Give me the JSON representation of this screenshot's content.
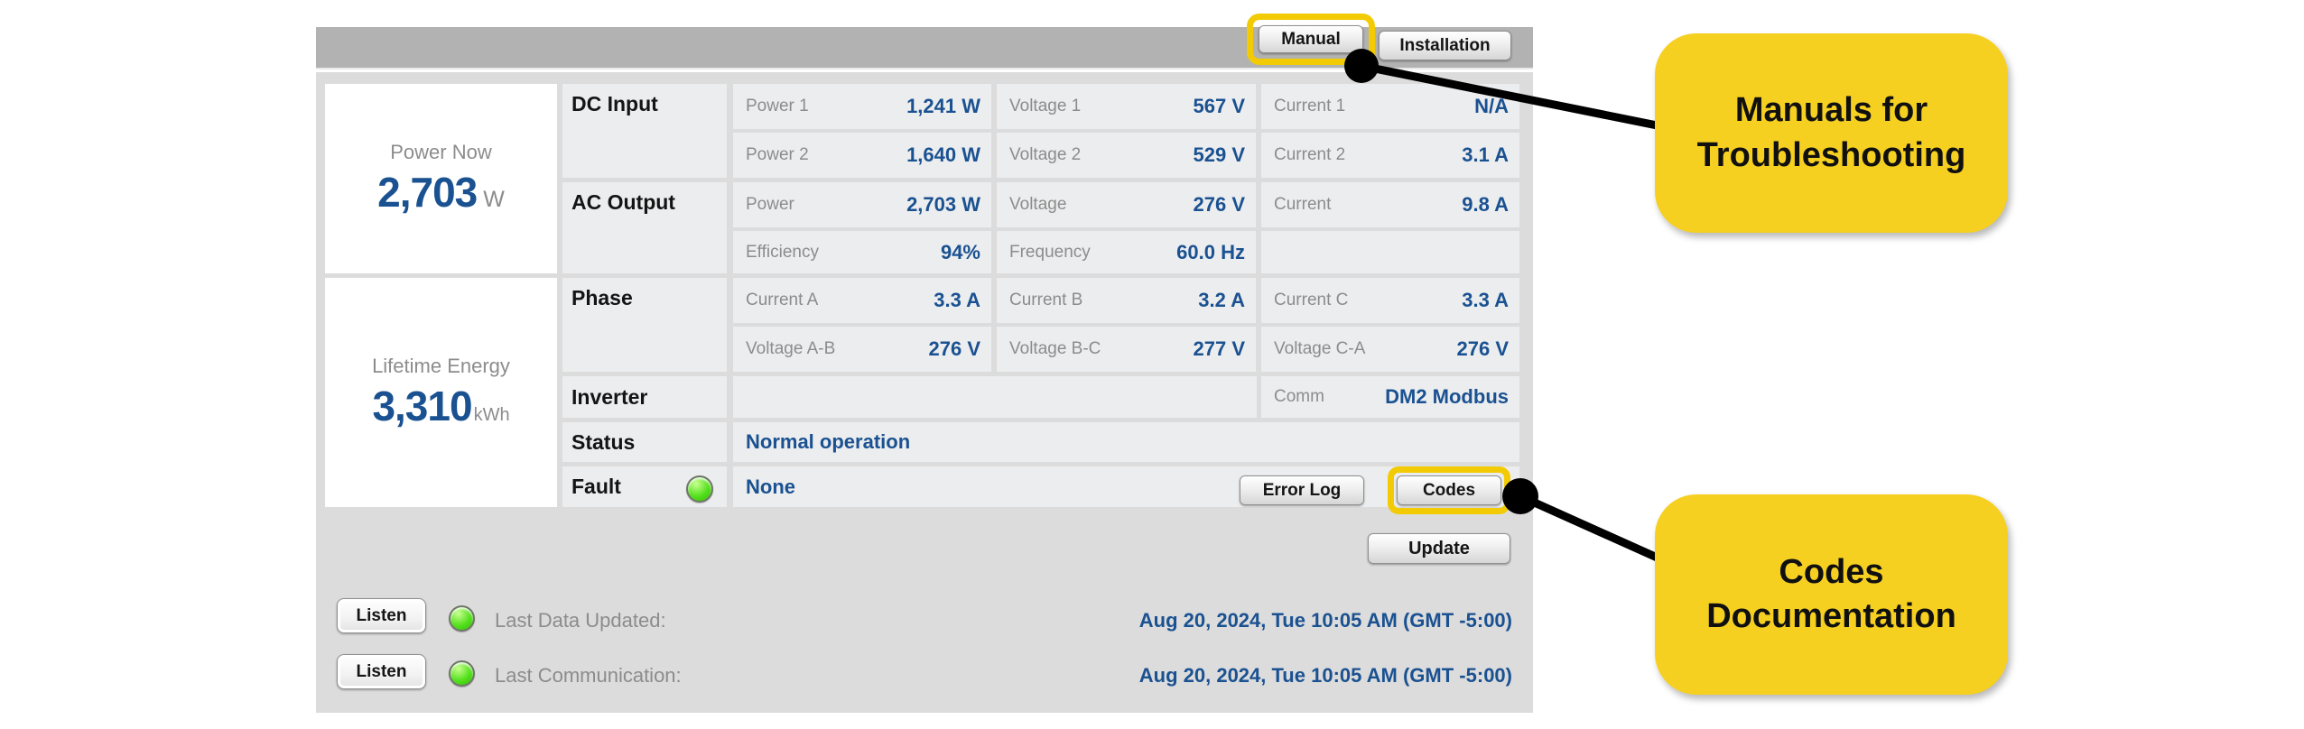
{
  "header": {
    "manual_button": "Manual",
    "installation_button": "Installation"
  },
  "summary": {
    "power_now": {
      "label": "Power Now",
      "value": "2,703",
      "unit": "W"
    },
    "lifetime_energy": {
      "label": "Lifetime Energy",
      "value": "3,310",
      "unit": "kWh"
    }
  },
  "table": {
    "dc_label": "DC Input",
    "dc": [
      {
        "l": "Power 1",
        "v": "1,241 W"
      },
      {
        "l": "Voltage 1",
        "v": "567 V"
      },
      {
        "l": "Current 1",
        "v": "N/A"
      },
      {
        "l": "Power 2",
        "v": "1,640 W"
      },
      {
        "l": "Voltage 2",
        "v": "529 V"
      },
      {
        "l": "Current 2",
        "v": "3.1 A"
      }
    ],
    "ac_label": "AC Output",
    "ac": [
      {
        "l": "Power",
        "v": "2,703 W"
      },
      {
        "l": "Voltage",
        "v": "276 V"
      },
      {
        "l": "Current",
        "v": "9.8 A"
      },
      {
        "l": "Efficiency",
        "v": "94%"
      },
      {
        "l": "Frequency",
        "v": "60.0 Hz"
      }
    ],
    "phase_label": "Phase",
    "phase": [
      {
        "l": "Current A",
        "v": "3.3 A"
      },
      {
        "l": "Current B",
        "v": "3.2 A"
      },
      {
        "l": "Current C",
        "v": "3.3 A"
      },
      {
        "l": "Voltage A-B",
        "v": "276 V"
      },
      {
        "l": "Voltage B-C",
        "v": "277 V"
      },
      {
        "l": "Voltage C-A",
        "v": "276 V"
      }
    ],
    "inverter_label": "Inverter",
    "comm_label": "Comm",
    "comm_value": "DM2 Modbus",
    "status_label": "Status",
    "status_value": "Normal operation",
    "fault_label": "Fault",
    "fault_value": "None",
    "error_log_button": "Error Log",
    "codes_button": "Codes"
  },
  "update_button": "Update",
  "footer": {
    "rows": [
      {
        "button": "Listen",
        "label": "Last Data Updated:",
        "timestamp": "Aug 20, 2024, Tue 10:05 AM (GMT -5:00)"
      },
      {
        "button": "Listen",
        "label": "Last Communication:",
        "timestamp": "Aug 20, 2024, Tue 10:05 AM (GMT -5:00)"
      }
    ]
  },
  "annotations": {
    "manual_callout": {
      "line1": "Manuals for",
      "line2": "Troubleshooting"
    },
    "codes_callout": {
      "line1": "Codes",
      "line2": "Documentation"
    }
  },
  "colors": {
    "accent_blue": "#1A5191",
    "callout_yellow": "#F6D020",
    "highlight_ring_yellow": "#F2CB05",
    "led_green": "#3FD60A",
    "header_gray": "#B2B2B2",
    "content_gray": "#DCDCDC",
    "cell_gray": "#ECEDEE"
  }
}
